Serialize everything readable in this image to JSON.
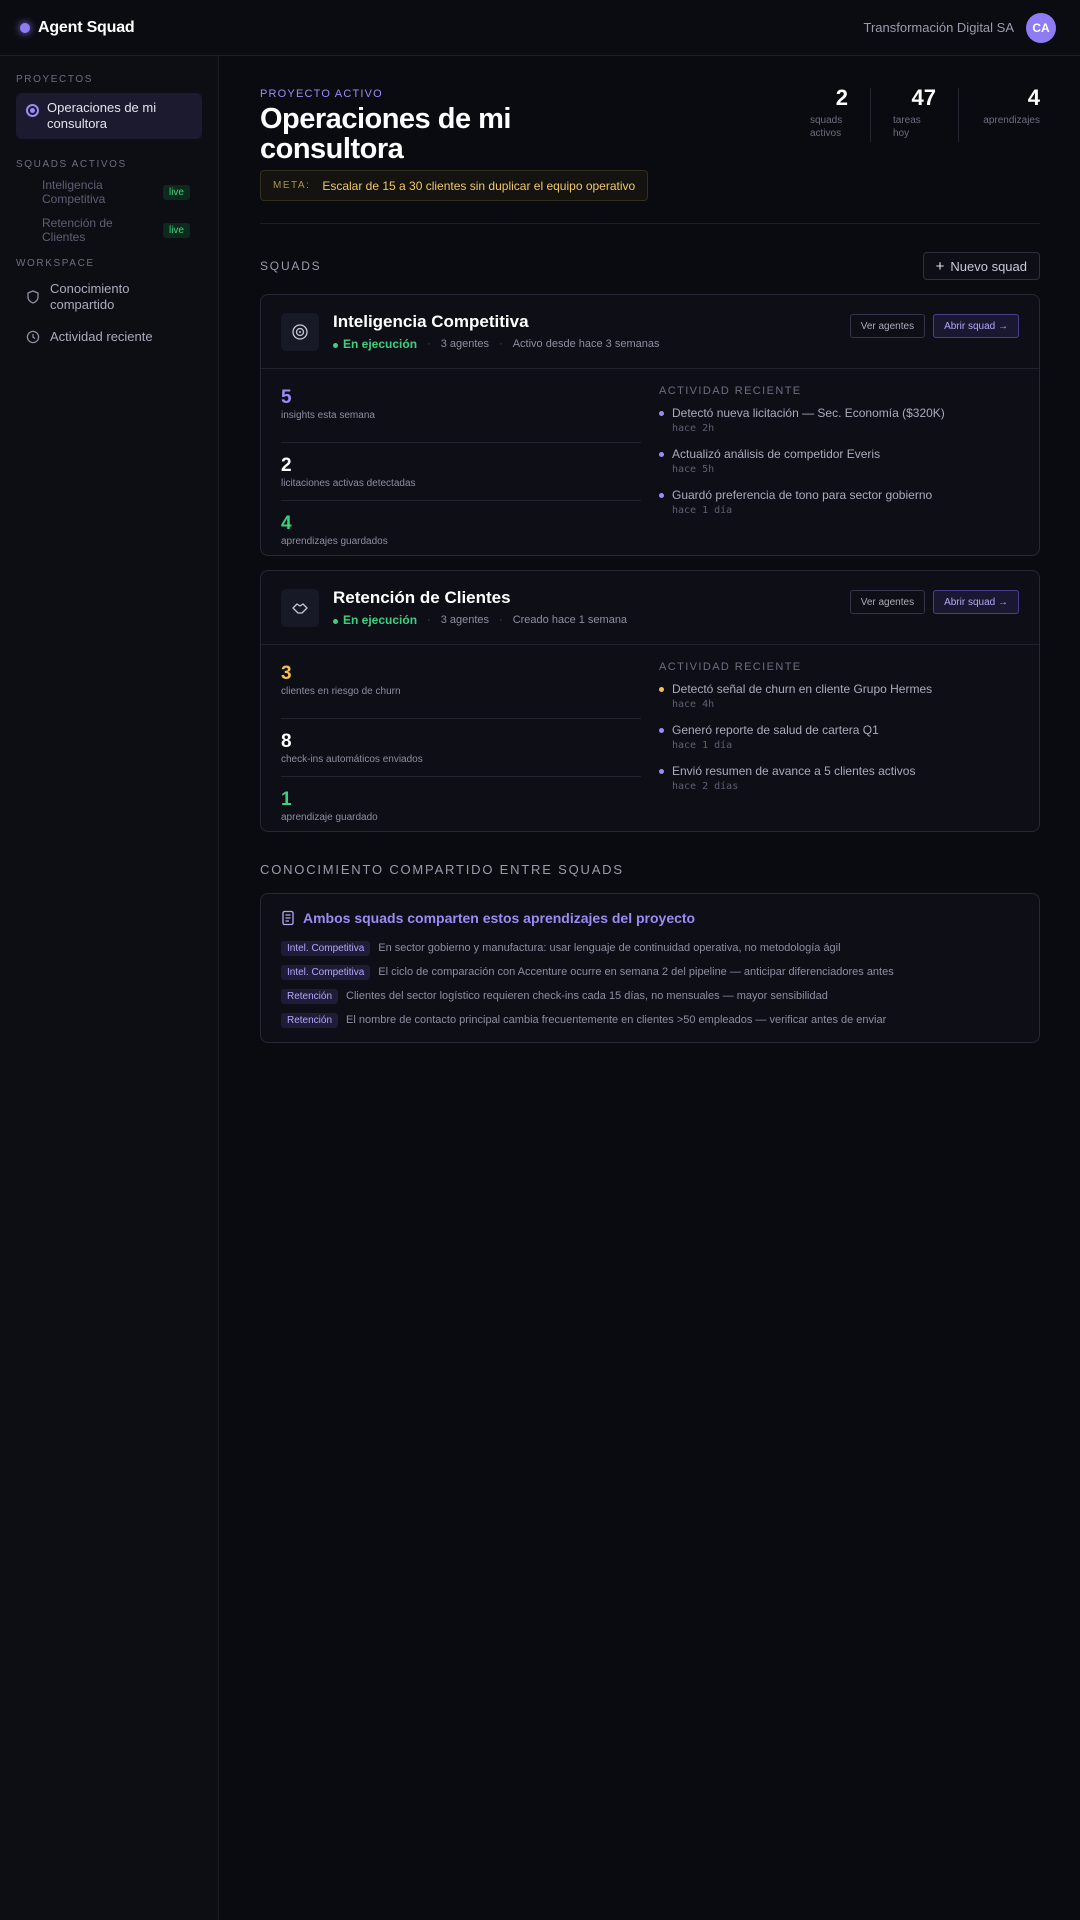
{
  "app": {
    "brand": "Agent Squad",
    "org": "Transformación Digital SA",
    "avatar": "CA"
  },
  "sidebar": {
    "projects_heading": "PROYECTOS",
    "active_project": "Operaciones de mi consultora",
    "squads_heading": "SQUADS ACTIVOS",
    "squads": [
      {
        "label": "Inteligencia Competitiva",
        "badge": "live"
      },
      {
        "label": "Retención de Clientes",
        "badge": "live"
      }
    ],
    "workspace_heading": "WORKSPACE",
    "workspace_items": [
      {
        "label": "Conocimiento compartido",
        "icon": "shield-icon"
      },
      {
        "label": "Actividad reciente",
        "icon": "clock-icon"
      }
    ]
  },
  "project": {
    "eyebrow": "PROYECTO ACTIVO",
    "title": "Operaciones de mi consultora",
    "goal_label": "META:",
    "goal_text": "Escalar de 15 a 30 clientes sin duplicar el equipo operativo"
  },
  "stats": [
    {
      "value": "2",
      "label": "squads activos"
    },
    {
      "value": "47",
      "label": "tareas hoy"
    },
    {
      "value": "4",
      "label": "aprendizajes"
    }
  ],
  "squads_section": {
    "title": "SQUADS",
    "new_button": "Nuevo squad"
  },
  "squads": [
    {
      "name": "Inteligencia Competitiva",
      "icon": "radar-icon",
      "status": "En ejecución",
      "agents": "3 agentes",
      "since": "Activo desde hace 3 semanas",
      "view_agents": "Ver agentes",
      "open": "Abrir squad →",
      "metrics": [
        {
          "value": "5",
          "label": "insights esta semana",
          "color": "#9a8cf6"
        },
        {
          "value": "2",
          "label": "licitaciones activas detectadas",
          "color": "#ffffff"
        },
        {
          "value": "4",
          "label": "aprendizajes guardados",
          "color": "#3ed07f"
        }
      ],
      "activity_title": "ACTIVIDAD RECIENTE",
      "activity": [
        {
          "text": "Detectó nueva licitación — Sec. Economía ($320K)",
          "time": "hace 2h",
          "color": "#9a8cf6"
        },
        {
          "text": "Actualizó análisis de competidor Everis",
          "time": "hace 5h",
          "color": "#9a8cf6"
        },
        {
          "text": "Guardó preferencia de tono para sector gobierno",
          "time": "hace 1 día",
          "color": "#9a8cf6"
        }
      ]
    },
    {
      "name": "Retención de Clientes",
      "icon": "handshake-icon",
      "status": "En ejecución",
      "agents": "3 agentes",
      "since": "Creado hace 1 semana",
      "view_agents": "Ver agentes",
      "open": "Abrir squad →",
      "metrics": [
        {
          "value": "3",
          "label": "clientes en riesgo de churn",
          "color": "#f2c14e"
        },
        {
          "value": "8",
          "label": "check-ins automáticos enviados",
          "color": "#ffffff"
        },
        {
          "value": "1",
          "label": "aprendizaje guardado",
          "color": "#3ed07f"
        }
      ],
      "activity_title": "ACTIVIDAD RECIENTE",
      "activity": [
        {
          "text": "Detectó señal de churn en cliente Grupo Hermes",
          "time": "hace 4h",
          "color": "#f2c14e"
        },
        {
          "text": "Generó reporte de salud de cartera Q1",
          "time": "hace 1 día",
          "color": "#9a8cf6"
        },
        {
          "text": "Envió resumen de avance a 5 clientes activos",
          "time": "hace 2 días",
          "color": "#9a8cf6"
        }
      ]
    }
  ],
  "shared": {
    "title": "CONOCIMIENTO COMPARTIDO ENTRE SQUADS",
    "heading": "Ambos squads comparten estos aprendizajes del proyecto",
    "items": [
      {
        "tag": "Intel. Competitiva",
        "text": "En sector gobierno y manufactura: usar lenguaje de continuidad operativa, no metodología ágil"
      },
      {
        "tag": "Intel. Competitiva",
        "text": "El ciclo de comparación con Accenture ocurre en semana 2 del pipeline — anticipar diferenciadores antes"
      },
      {
        "tag": "Retención",
        "text": "Clientes del sector logístico requieren check-ins cada 15 días, no mensuales — mayor sensibilidad"
      },
      {
        "tag": "Retención",
        "text": "El nombre de contacto principal cambia frecuentemente en clientes >50 empleados — verificar antes de enviar"
      }
    ]
  }
}
